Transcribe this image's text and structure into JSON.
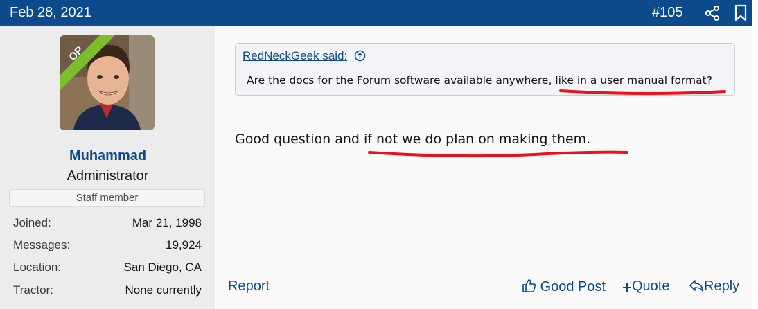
{
  "header": {
    "date": "Feb 28, 2021",
    "post_number": "#105",
    "colors": {
      "bar": "#0c4a8c",
      "text": "#ffffff"
    },
    "icons": [
      "share-icon",
      "bookmark-icon"
    ]
  },
  "user": {
    "ribbon": "OP",
    "name": "Muhammad",
    "title": "Administrator",
    "badge": "Staff member",
    "stats": [
      {
        "label": "Joined:",
        "value": "Mar 21, 1998"
      },
      {
        "label": "Messages:",
        "value": "19,924"
      },
      {
        "label": "Location:",
        "value": "San Diego, CA"
      },
      {
        "label": "Tractor:",
        "value": "None currently"
      }
    ]
  },
  "quote": {
    "author": "RedNeckGeek said:",
    "text": "Are the docs for the Forum software available anywhere, like in a user manual format?"
  },
  "post": {
    "text": "Good question and if not we do plan on making them."
  },
  "actions": {
    "report": "Report",
    "like": "Good Post",
    "quote": "Quote",
    "reply": "Reply"
  },
  "colors": {
    "link": "#0c4a8c",
    "annotation": "#e8121b"
  }
}
